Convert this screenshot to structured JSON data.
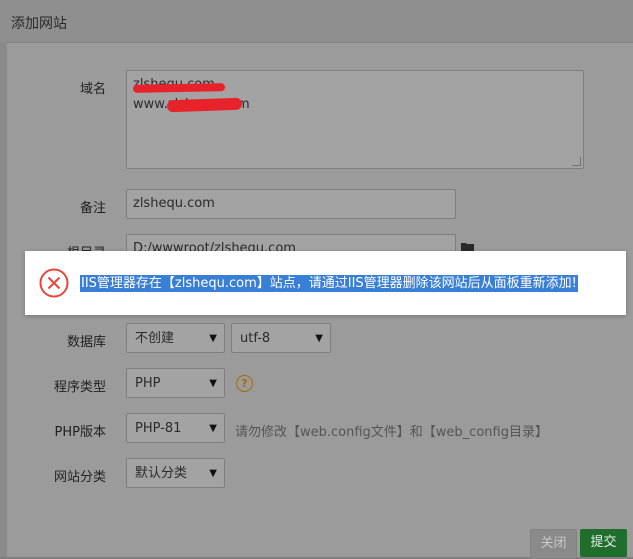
{
  "dialog": {
    "title": "添加网站",
    "domain": {
      "label": "域名",
      "lines": [
        "zlshequ.com",
        "www.zlshequ.com"
      ],
      "redacted": true
    },
    "note": {
      "label": "备注",
      "value": "zlshequ.com"
    },
    "root": {
      "label": "根目录",
      "value": "D:/wwwroot/zlshequ.com"
    },
    "database": {
      "label": "数据库",
      "value": "不创建",
      "charset": "utf-8"
    },
    "program_type": {
      "label": "程序类型",
      "value": "PHP",
      "help": "?"
    },
    "php_version": {
      "label": "PHP版本",
      "value": "PHP-81",
      "hint": "请勿修改【web.config文件】和【web_config目录】"
    },
    "category": {
      "label": "网站分类",
      "value": "默认分类"
    },
    "buttons": {
      "close": "关闭",
      "submit": "提交"
    }
  },
  "toast": {
    "message": "IIS管理器存在【zlshequ.com】站点，请通过IIS管理器删除该网站后从面板重新添加!",
    "icon": "error-circle-icon",
    "icon_color": "#e8463e"
  },
  "colors": {
    "overlay": "#7f7f7f",
    "submit": "#1f6e2d",
    "selection": "#3a7fd6"
  }
}
